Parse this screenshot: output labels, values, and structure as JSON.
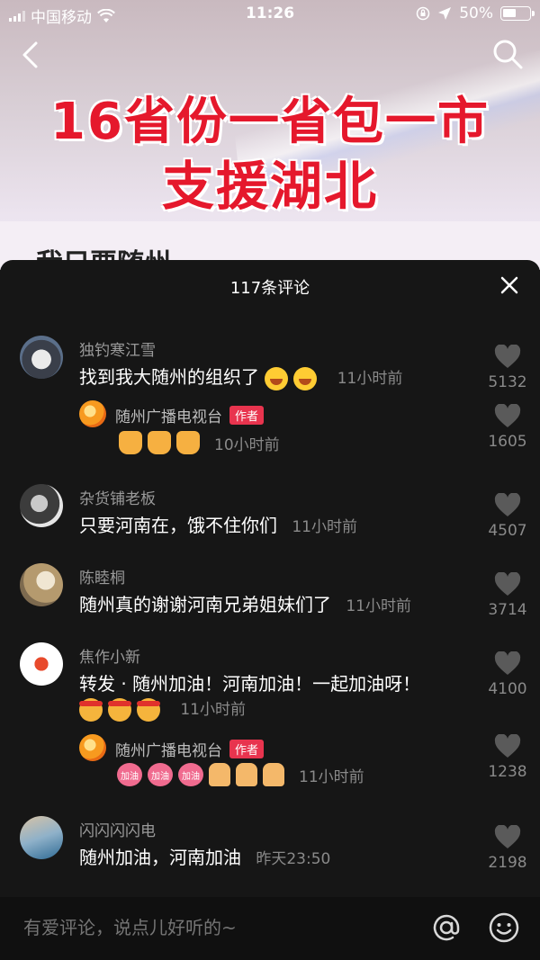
{
  "status_bar": {
    "carrier": "中国移动",
    "time": "11:26",
    "battery_percent": "50%"
  },
  "video": {
    "headline_line1": "16省份一省包一市",
    "headline_line2": "支援湖北",
    "subtitle": "我只要随州"
  },
  "comments_sheet": {
    "title": "117条评论",
    "comments": [
      {
        "user": "独钓寒江雪",
        "text": "找到我大随州的组织了",
        "time": "11小时前",
        "likes": "5132",
        "reply": {
          "user": "随州广播电视台",
          "tag": "作者",
          "time": "10小时前",
          "likes": "1605"
        }
      },
      {
        "user": "杂货铺老板",
        "text": "只要河南在，饿不住你们",
        "time": "11小时前",
        "likes": "4507"
      },
      {
        "user": "陈睦桐",
        "text": "随州真的谢谢河南兄弟姐妹们了",
        "time": "11小时前",
        "likes": "3714"
      },
      {
        "user": "焦作小新",
        "text": "转发 · 随州加油！河南加油！一起加油呀！",
        "time": "11小时前",
        "likes": "4100",
        "reply": {
          "user": "随州广播电视台",
          "tag": "作者",
          "emoji_label": "加油",
          "time": "11小时前",
          "likes": "1238"
        }
      },
      {
        "user": "闪闪闪闪电",
        "text": "随州加油，河南加油",
        "time": "昨天23:50",
        "likes": "2198"
      }
    ]
  },
  "input_bar": {
    "placeholder": "有爱评论，说点儿好听的~"
  },
  "colors": {
    "sheet_bg": "#161616",
    "accent_red": "#e8344e",
    "headline_red": "#e5182c"
  }
}
